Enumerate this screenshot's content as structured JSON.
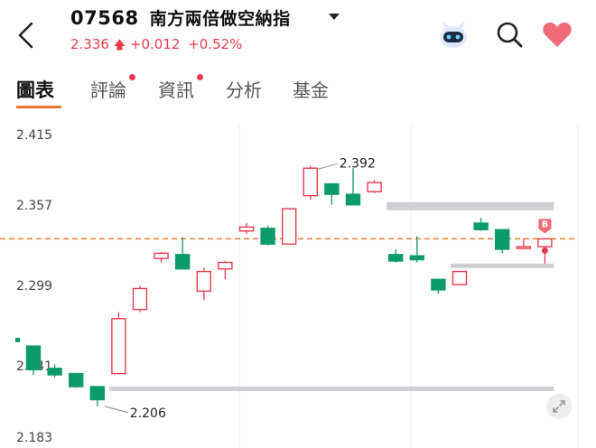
{
  "header": {
    "code": "07568",
    "name": "南方兩倍做空納指",
    "price": "2.336",
    "change": "+0.012",
    "change_pct": "+0.52%",
    "up_color": "#ea3a4e",
    "down_color": "#0e9b6a"
  },
  "icons": [
    "back-arrow-icon",
    "dropdown-caret-icon",
    "robot-assistant-icon",
    "search-icon",
    "heart-icon",
    "expand-icon"
  ],
  "tabs": [
    {
      "label": "圖表",
      "active": true,
      "dot": false
    },
    {
      "label": "評論",
      "active": false,
      "dot": true
    },
    {
      "label": "資訊",
      "active": false,
      "dot": true
    },
    {
      "label": "分析",
      "active": false,
      "dot": false
    },
    {
      "label": "基金",
      "active": false,
      "dot": false
    }
  ],
  "chart_data": {
    "type": "candlestick",
    "y_ticks": [
      "2.415",
      "2.357",
      "2.299",
      "2.241",
      "2.183"
    ],
    "ylim": [
      2.183,
      2.415
    ],
    "reference_price": 2.336,
    "high_label": "2.392",
    "low_label": "2.206",
    "marker": "B",
    "candles": [
      {
        "o": 2.254,
        "c": 2.236,
        "h": 2.254,
        "l": 2.232
      },
      {
        "o": 2.237,
        "c": 2.232,
        "h": 2.24,
        "l": 2.23
      },
      {
        "o": 2.233,
        "c": 2.223,
        "h": 2.233,
        "l": 2.222
      },
      {
        "o": 2.223,
        "c": 2.213,
        "h": 2.223,
        "l": 2.208
      },
      {
        "o": 2.233,
        "c": 2.275,
        "h": 2.28,
        "l": 2.233
      },
      {
        "o": 2.282,
        "c": 2.298,
        "h": 2.3,
        "l": 2.28
      },
      {
        "o": 2.321,
        "c": 2.325,
        "h": 2.326,
        "l": 2.318
      },
      {
        "o": 2.324,
        "c": 2.313,
        "h": 2.337,
        "l": 2.313
      },
      {
        "o": 2.296,
        "c": 2.311,
        "h": 2.314,
        "l": 2.289
      },
      {
        "o": 2.313,
        "c": 2.318,
        "h": 2.319,
        "l": 2.305
      },
      {
        "o": 2.342,
        "c": 2.345,
        "h": 2.348,
        "l": 2.34
      },
      {
        "o": 2.344,
        "c": 2.332,
        "h": 2.346,
        "l": 2.331
      },
      {
        "o": 2.332,
        "c": 2.359,
        "h": 2.359,
        "l": 2.332
      },
      {
        "o": 2.369,
        "c": 2.39,
        "h": 2.392,
        "l": 2.366
      },
      {
        "o": 2.378,
        "c": 2.37,
        "h": 2.378,
        "l": 2.362
      },
      {
        "o": 2.37,
        "c": 2.362,
        "h": 2.39,
        "l": 2.362
      },
      {
        "o": 2.372,
        "c": 2.379,
        "h": 2.381,
        "l": 2.371
      },
      {
        "o": 2.324,
        "c": 2.319,
        "h": 2.328,
        "l": 2.318
      },
      {
        "o": 2.323,
        "c": 2.32,
        "h": 2.338,
        "l": 2.318
      },
      {
        "o": 2.305,
        "c": 2.297,
        "h": 2.305,
        "l": 2.294
      },
      {
        "o": 2.301,
        "c": 2.311,
        "h": 2.311,
        "l": 2.301
      },
      {
        "o": 2.348,
        "c": 2.343,
        "h": 2.352,
        "l": 2.342
      },
      {
        "o": 2.343,
        "c": 2.328,
        "h": 2.343,
        "l": 2.325
      },
      {
        "o": 2.329,
        "c": 2.33,
        "h": 2.336,
        "l": 2.328
      },
      {
        "o": 2.33,
        "c": 2.336,
        "h": 2.336,
        "l": 2.317
      }
    ],
    "bands": [
      {
        "y": 2.362,
        "from": 17,
        "to": 24
      },
      {
        "y": 2.315,
        "from": 20,
        "to": 24
      },
      {
        "y": 2.221,
        "from": 4,
        "to": 24
      }
    ]
  }
}
